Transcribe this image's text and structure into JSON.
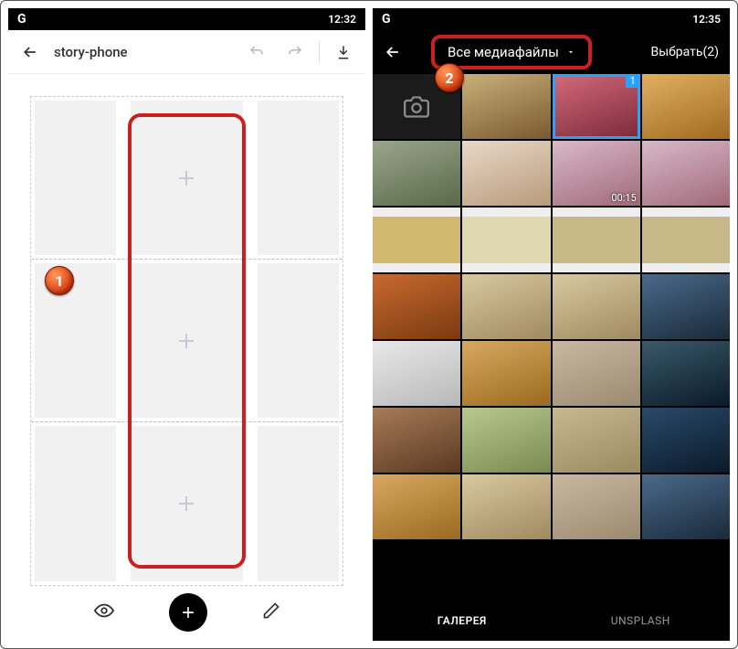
{
  "left": {
    "status": {
      "logo": "G",
      "time": "12:32"
    },
    "toolbar": {
      "title": "story-phone"
    },
    "marker": "1"
  },
  "right": {
    "status": {
      "logo": "G",
      "time": "12:35"
    },
    "toolbar": {
      "dropdown_label": "Все медиафайлы",
      "select_label": "Выбрать(2)"
    },
    "marker": "2",
    "selected_badge": "1",
    "video_duration": "00:15",
    "tabs": {
      "gallery": "ГАЛЕРЕЯ",
      "unsplash": "UNSPLASH"
    }
  }
}
